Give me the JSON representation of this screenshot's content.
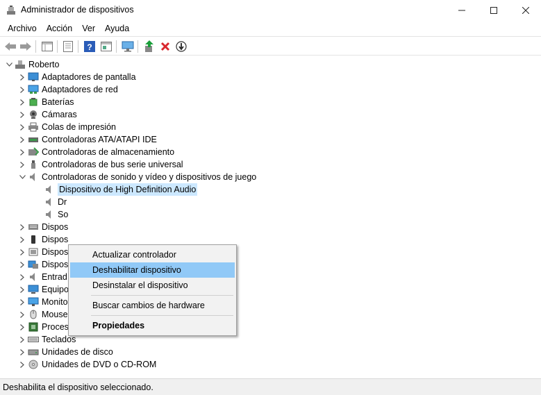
{
  "window": {
    "title": "Administrador de dispositivos"
  },
  "menu": [
    "Archivo",
    "Acción",
    "Ver",
    "Ayuda"
  ],
  "toolbar": {
    "icons": [
      "back-icon",
      "forward-icon",
      "properties-pane-icon",
      "show-hide-tree-icon",
      "help-icon",
      "action-pane-icon",
      "scan-hardware-icon",
      "update-driver-icon",
      "uninstall-icon",
      "disable-device-icon"
    ]
  },
  "tree": {
    "root": "Roberto",
    "categories": [
      "Adaptadores de pantalla",
      "Adaptadores de red",
      "Baterías",
      "Cámaras",
      "Colas de impresión",
      "Controladoras ATA/ATAPI IDE",
      "Controladoras de almacenamiento",
      "Controladoras de bus serie universal",
      "Controladoras de sonido y vídeo y dispositivos de juego"
    ],
    "audio_children": [
      "Dispositivo de High Definition Audio",
      "Dr",
      "So"
    ],
    "partial_categories": [
      "Dispos",
      "Dispos",
      "Dispos",
      "Dispos",
      "Entrad"
    ],
    "categories_after": [
      "Equipo",
      "Monitores",
      "Mouse y otros dispositivos señaladores",
      "Procesadores",
      "Teclados",
      "Unidades de disco",
      "Unidades de DVD o CD-ROM"
    ]
  },
  "context_menu": {
    "items": [
      "Actualizar controlador",
      "Deshabilitar dispositivo",
      "Desinstalar el dispositivo",
      "Buscar cambios de hardware",
      "Propiedades"
    ],
    "highlighted_index": 1
  },
  "status": "Deshabilita el dispositivo seleccionado.",
  "colors": {
    "selection": "#cce8ff",
    "menu_highlight": "#91c9f7",
    "disable_icon": "#1a9e3a",
    "delete_icon": "#d9272e"
  }
}
